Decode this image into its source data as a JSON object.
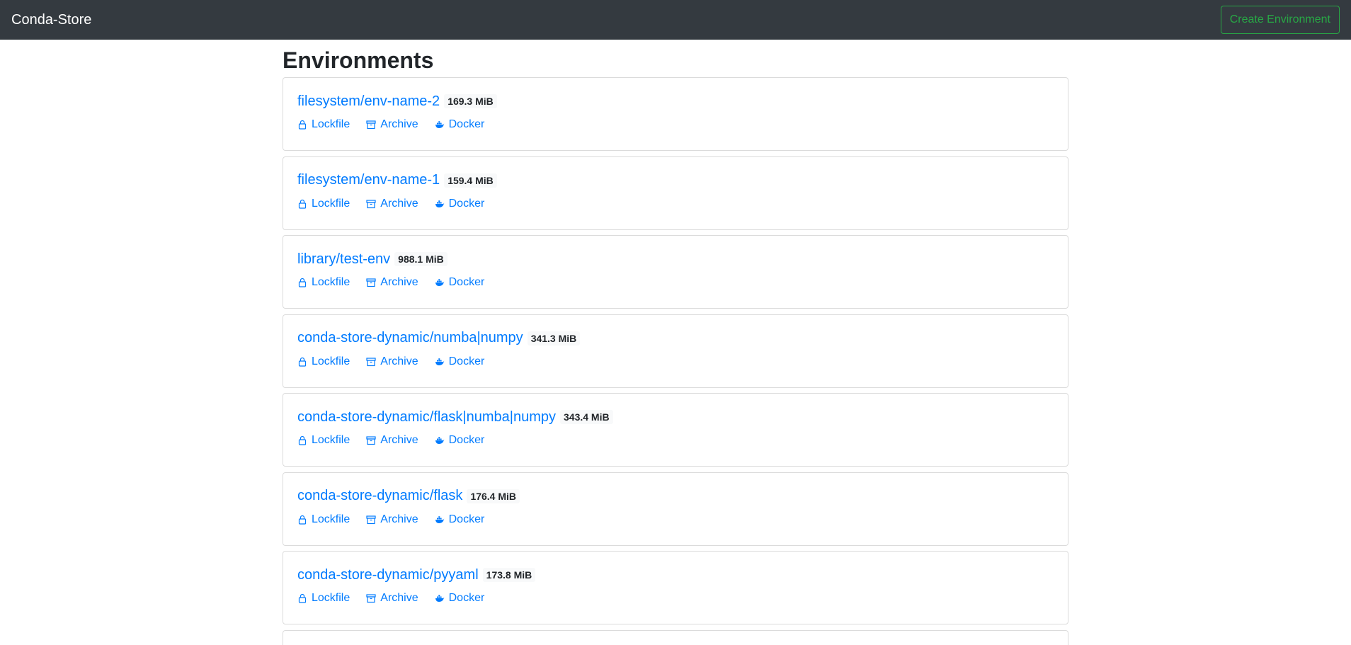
{
  "navbar": {
    "brand": "Conda-Store",
    "create_button_label": "Create Environment"
  },
  "page": {
    "title": "Environments"
  },
  "environments": [
    {
      "name": "filesystem/env-name-2",
      "size": "169.3 MiB",
      "links": {
        "lockfile": "Lockfile",
        "archive": "Archive",
        "docker": "Docker"
      }
    },
    {
      "name": "filesystem/env-name-1",
      "size": "159.4 MiB",
      "links": {
        "lockfile": "Lockfile",
        "archive": "Archive",
        "docker": "Docker"
      }
    },
    {
      "name": "library/test-env",
      "size": "988.1 MiB",
      "links": {
        "lockfile": "Lockfile",
        "archive": "Archive",
        "docker": "Docker"
      }
    },
    {
      "name": "conda-store-dynamic/numba|numpy",
      "size": "341.3 MiB",
      "links": {
        "lockfile": "Lockfile",
        "archive": "Archive",
        "docker": "Docker"
      }
    },
    {
      "name": "conda-store-dynamic/flask|numba|numpy",
      "size": "343.4 MiB",
      "links": {
        "lockfile": "Lockfile",
        "archive": "Archive",
        "docker": "Docker"
      }
    },
    {
      "name": "conda-store-dynamic/flask",
      "size": "176.4 MiB",
      "links": {
        "lockfile": "Lockfile",
        "archive": "Archive",
        "docker": "Docker"
      }
    },
    {
      "name": "conda-store-dynamic/pyyaml",
      "size": "173.8 MiB",
      "links": {
        "lockfile": "Lockfile",
        "archive": "Archive",
        "docker": "Docker"
      }
    }
  ],
  "icons": {
    "lockfile": "lock-icon",
    "archive": "archive-box-icon",
    "docker": "docker-whale-icon"
  },
  "colors": {
    "navbar_bg": "#343a40",
    "link": "#007bff",
    "create_button": "#28a745"
  }
}
